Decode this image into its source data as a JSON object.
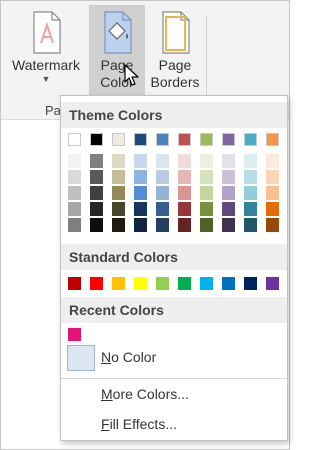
{
  "ribbon": {
    "watermark_label": "Watermark",
    "page_color_line1": "Page",
    "page_color_line2": "Color",
    "page_borders_line1": "Page",
    "page_borders_line2": "Borders",
    "group_label_fragment": "Pa"
  },
  "menu": {
    "theme_header": "Theme Colors",
    "standard_header": "Standard Colors",
    "recent_header": "Recent Colors",
    "no_color_prefix": "N",
    "no_color_rest": "o Color",
    "more_colors_prefix": "M",
    "more_colors_rest": "ore Colors...",
    "fill_effects_prefix": "F",
    "fill_effects_rest": "ill Effects..."
  },
  "theme_colors": [
    {
      "base": "#ffffff",
      "tints": [
        "#f2f2f2",
        "#d9d9d9",
        "#bfbfbf",
        "#a6a6a6",
        "#7f7f7f"
      ]
    },
    {
      "base": "#000000",
      "tints": [
        "#7f7f7f",
        "#595959",
        "#404040",
        "#262626",
        "#0d0d0d"
      ]
    },
    {
      "base": "#eeece1",
      "tints": [
        "#ddd9c3",
        "#c4bd97",
        "#948a54",
        "#4a452a",
        "#1e1c11"
      ]
    },
    {
      "base": "#1f497d",
      "tints": [
        "#c6d9f0",
        "#8db3e2",
        "#548dd4",
        "#17365d",
        "#0f243e"
      ]
    },
    {
      "base": "#4f81bd",
      "tints": [
        "#dbe5f1",
        "#b8cce4",
        "#95b3d7",
        "#366092",
        "#244061"
      ]
    },
    {
      "base": "#c0504d",
      "tints": [
        "#f2dcdb",
        "#e5b9b7",
        "#d99694",
        "#953734",
        "#632423"
      ]
    },
    {
      "base": "#9bbb59",
      "tints": [
        "#ebf1dd",
        "#d7e3bc",
        "#c3d69b",
        "#76923c",
        "#4f6128"
      ]
    },
    {
      "base": "#8064a2",
      "tints": [
        "#e5e0ec",
        "#ccc1d9",
        "#b2a2c7",
        "#5f497a",
        "#3f3151"
      ]
    },
    {
      "base": "#4bacc6",
      "tints": [
        "#dbeef3",
        "#b7dde8",
        "#92cddc",
        "#31859b",
        "#205867"
      ]
    },
    {
      "base": "#f79646",
      "tints": [
        "#fdeada",
        "#fbd5b5",
        "#fac08f",
        "#e36c09",
        "#974806"
      ]
    }
  ],
  "standard_colors": [
    "#c00000",
    "#ff0000",
    "#ffc000",
    "#ffff00",
    "#92d050",
    "#00b050",
    "#00b0f0",
    "#0070c0",
    "#002060",
    "#7030a0"
  ],
  "recent_colors": [
    "#e8127b"
  ]
}
